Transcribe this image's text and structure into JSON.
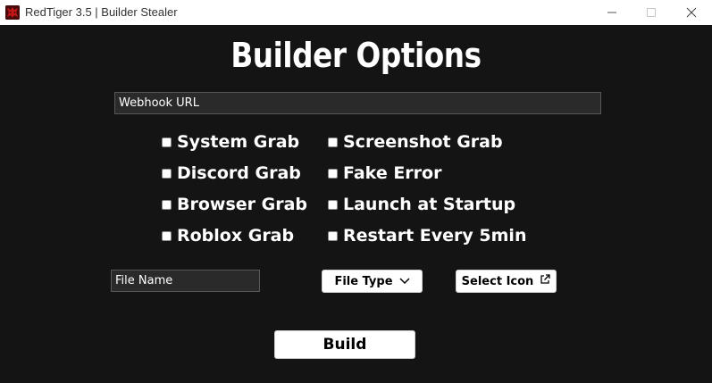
{
  "window": {
    "title": "RedTiger 3.5 | Builder Stealer"
  },
  "heading": "Builder Options",
  "webhook": {
    "placeholder": "Webhook URL"
  },
  "options": {
    "left": [
      {
        "label": "System Grab"
      },
      {
        "label": "Discord Grab"
      },
      {
        "label": "Browser Grab"
      },
      {
        "label": "Roblox Grab"
      }
    ],
    "right": [
      {
        "label": "Screenshot Grab"
      },
      {
        "label": "Fake Error"
      },
      {
        "label": "Launch at Startup"
      },
      {
        "label": "Restart Every 5min"
      }
    ]
  },
  "file_name": {
    "placeholder": "File Name"
  },
  "buttons": {
    "file_type": "File Type",
    "select_icon": "Select Icon",
    "build": "Build"
  },
  "icons": {
    "app": "tiger-logo-icon",
    "file_type": "chevron-down-icon",
    "select_icon": "external-link-icon",
    "minimize": "minimize-icon",
    "maximize": "maximize-icon",
    "close": "close-icon"
  },
  "colors": {
    "background": "#141414",
    "titlebar": "#ffffff",
    "text": "#ffffff",
    "input_bg": "#2a2a2a",
    "input_border": "#575757",
    "button_bg": "#ffffff"
  }
}
